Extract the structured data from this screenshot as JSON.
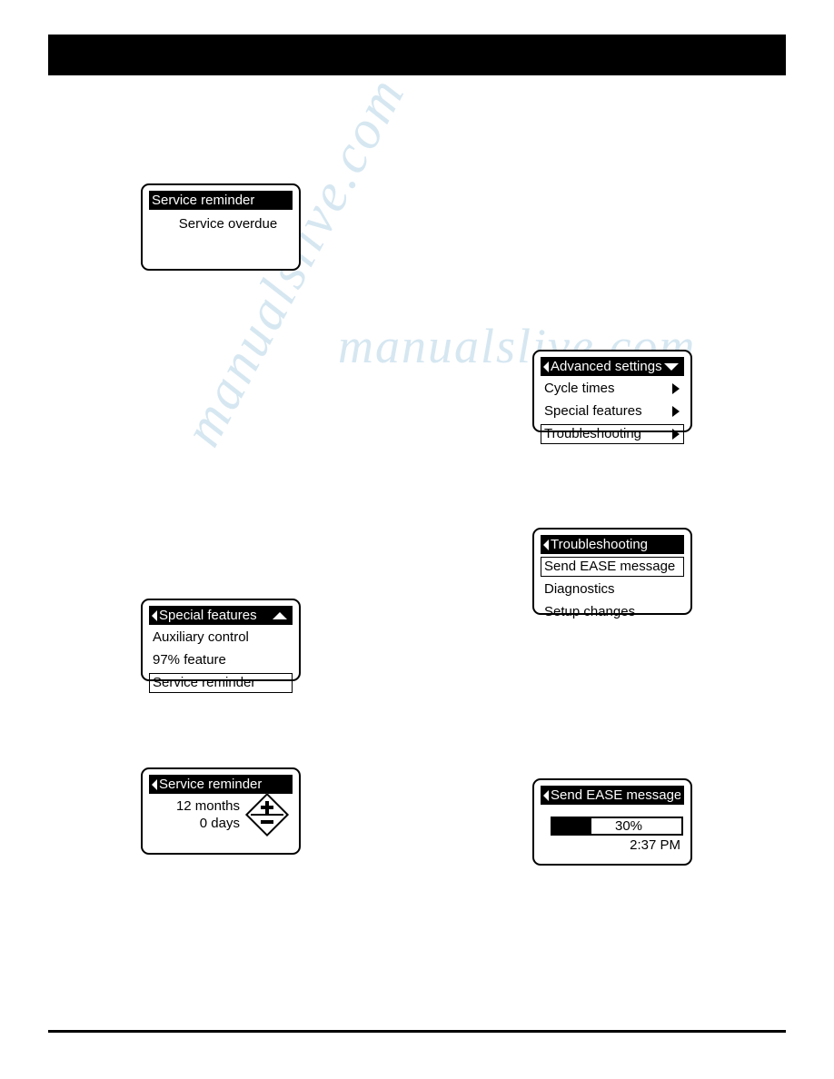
{
  "page": {
    "header_bar_color": "#000000",
    "background_color": "#ffffff"
  },
  "watermark": {
    "line1": "manualslive.com",
    "line2": "manualslive.com"
  },
  "screens": [
    {
      "id": "service-reminder-overdue",
      "title": "Service reminder",
      "title_back_arrow": false,
      "title_scroll_arrow": "none",
      "body_text": "Service overdue",
      "items": []
    },
    {
      "id": "advanced-settings",
      "title": "Advanced settings",
      "title_back_arrow": true,
      "title_scroll_arrow": "down",
      "items": [
        {
          "label": "Cycle times",
          "arrow": true,
          "selected": false
        },
        {
          "label": "Special features",
          "arrow": true,
          "selected": false
        },
        {
          "label": "Troubleshooting",
          "arrow": true,
          "selected": true
        }
      ]
    },
    {
      "id": "troubleshooting",
      "title": "Troubleshooting",
      "title_back_arrow": true,
      "title_scroll_arrow": "none",
      "items": [
        {
          "label": "Send EASE message",
          "arrow": false,
          "selected": true
        },
        {
          "label": "Diagnostics",
          "arrow": false,
          "selected": false
        },
        {
          "label": "Setup changes",
          "arrow": false,
          "selected": false
        }
      ]
    },
    {
      "id": "special-features",
      "title": "Special features",
      "title_back_arrow": true,
      "title_scroll_arrow": "up",
      "items": [
        {
          "label": "Auxiliary control",
          "arrow": false,
          "selected": false
        },
        {
          "label": "97% feature",
          "arrow": false,
          "selected": false
        },
        {
          "label": "Service reminder",
          "arrow": false,
          "selected": true
        }
      ]
    },
    {
      "id": "service-reminder-value",
      "title": "Service reminder",
      "title_back_arrow": true,
      "title_scroll_arrow": "none",
      "value_line1": "12 months",
      "value_line2": "0 days",
      "stepper": {
        "increase_icon": "plus-icon",
        "decrease_icon": "minus-icon"
      }
    },
    {
      "id": "send-ease-message",
      "title": "Send EASE message",
      "title_back_arrow": true,
      "title_scroll_arrow": "none",
      "progress_percent": 30,
      "progress_label": "30%",
      "clock": "2:37 PM"
    }
  ]
}
